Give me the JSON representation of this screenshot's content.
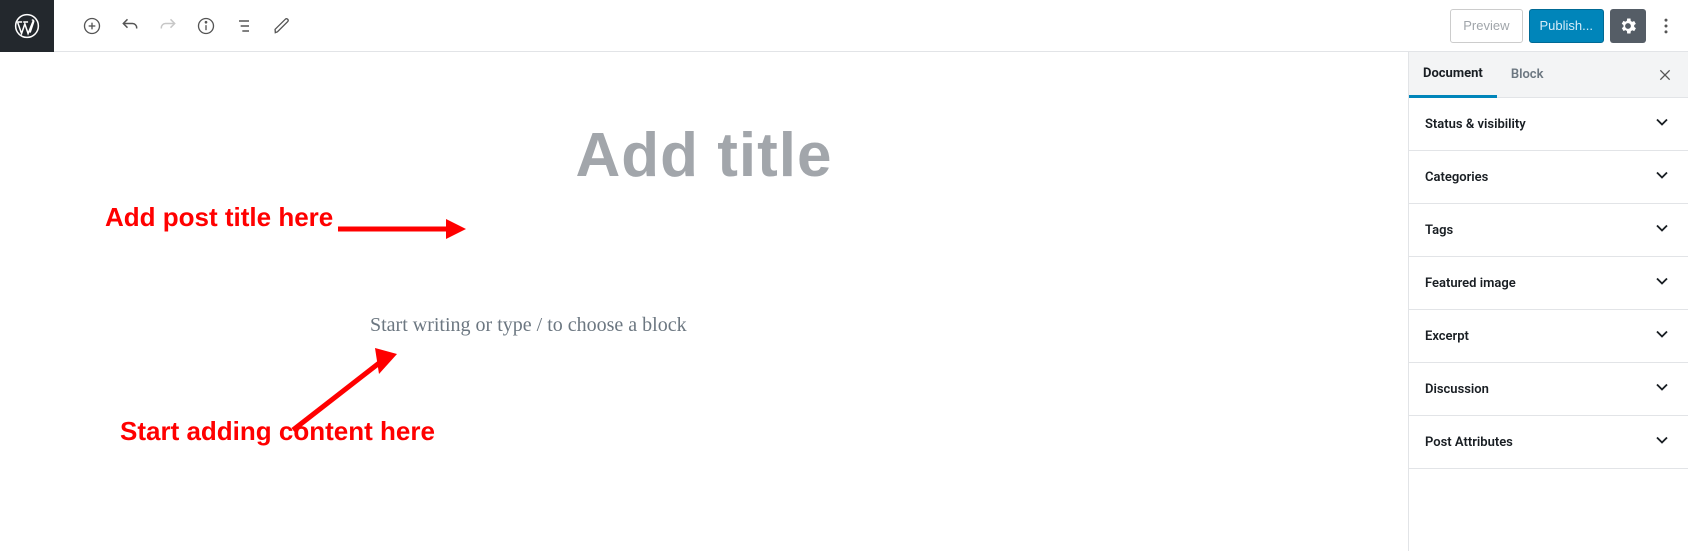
{
  "toolbar": {
    "preview_label": "Preview",
    "publish_label": "Publish..."
  },
  "editor": {
    "title_placeholder": "Add title",
    "content_placeholder": "Start writing or type / to choose a block"
  },
  "annotations": {
    "title_hint": "Add post title here",
    "content_hint": "Start adding content here"
  },
  "sidebar": {
    "tabs": {
      "document": "Document",
      "block": "Block"
    },
    "panels": [
      "Status & visibility",
      "Categories",
      "Tags",
      "Featured image",
      "Excerpt",
      "Discussion",
      "Post Attributes"
    ]
  }
}
